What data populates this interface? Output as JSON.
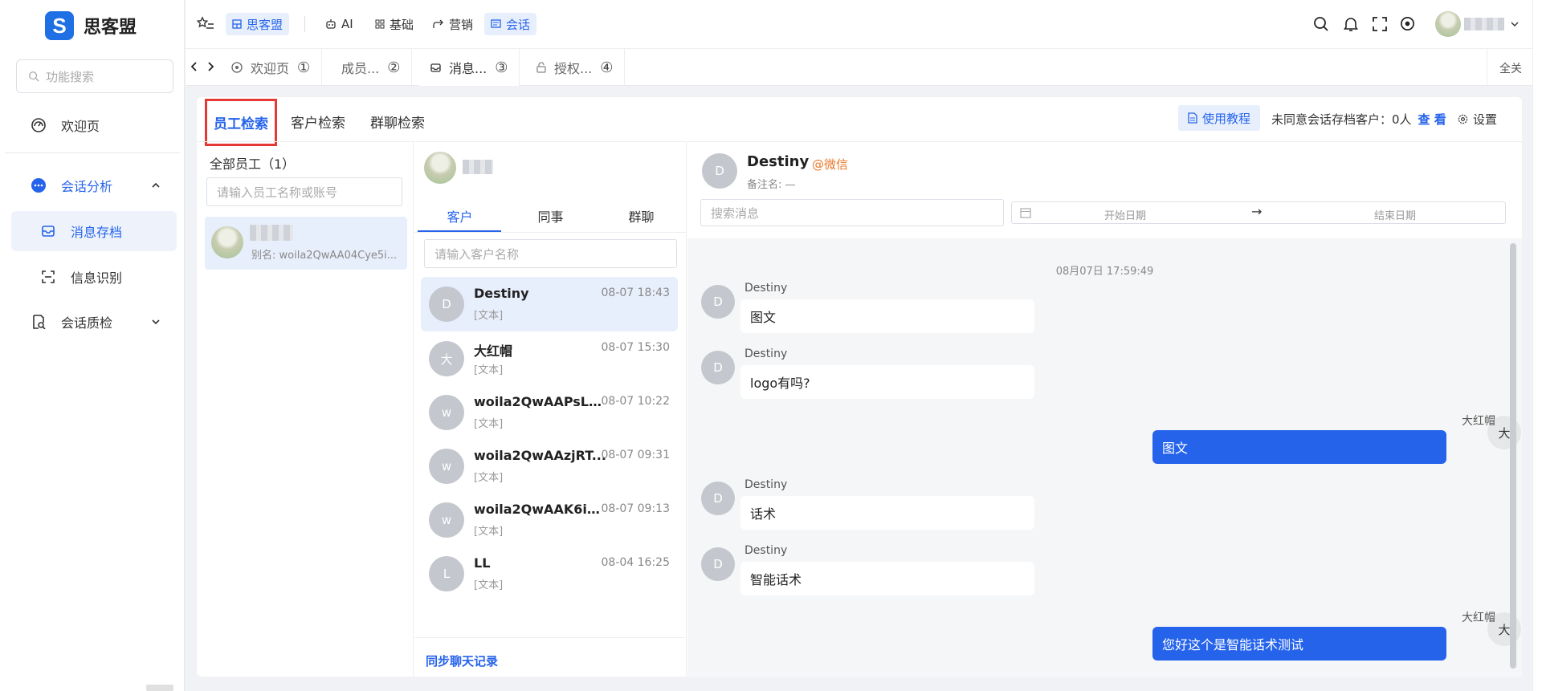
{
  "app": {
    "name": "思客盟",
    "logo_letter": "S",
    "brand_color": "#1f6fe5"
  },
  "sidebar": {
    "search_placeholder": "功能搜索",
    "items": [
      {
        "label": "欢迎页",
        "icon": "dashboard-icon"
      },
      {
        "label": "会话分析",
        "icon": "chat-bubble-icon",
        "expanded": true
      },
      {
        "label": "消息存档",
        "icon": "inbox-icon",
        "active": true
      },
      {
        "label": "信息识别",
        "icon": "scan-icon"
      },
      {
        "label": "会话质检",
        "icon": "inspect-icon",
        "expanded": false
      }
    ]
  },
  "topbar": {
    "menu": [
      {
        "label": "思客盟",
        "icon": "grid-icon",
        "active": true
      },
      {
        "label": "AI",
        "icon": "robot-icon"
      },
      {
        "label": "基础",
        "icon": "apps-icon"
      },
      {
        "label": "营销",
        "icon": "share-icon"
      },
      {
        "label": "会话",
        "icon": "message-icon",
        "active": true
      }
    ],
    "close_all": "全关"
  },
  "tabs": [
    {
      "label": "欢迎页",
      "num": "①",
      "icon": "dashboard-icon"
    },
    {
      "label": "成员...",
      "num": "②"
    },
    {
      "label": "消息...",
      "num": "③",
      "icon": "inbox-icon",
      "active": true
    },
    {
      "label": "授权...",
      "num": "④",
      "icon": "lock-icon"
    }
  ],
  "search_tabs": {
    "employee": "员工检索",
    "customer": "客户检索",
    "group": "群聊检索"
  },
  "toolbar": {
    "help": "使用教程",
    "consent_label": "未同意会话存档客户：0人",
    "view": "查 看",
    "settings": "设置"
  },
  "employees": {
    "header": "全部员工（1）",
    "search_placeholder": "请输入员工名称或账号",
    "list": [
      {
        "alias": "别名: woila2QwAA04Cye5i..."
      }
    ]
  },
  "contacts": {
    "tabs": [
      "客户",
      "同事",
      "群聊"
    ],
    "search_placeholder": "请输入客户名称",
    "list": [
      {
        "avatar": "D",
        "name": "Destiny",
        "time": "08-07 18:43",
        "preview": "[文本]"
      },
      {
        "avatar": "大",
        "name": "大红帽",
        "time": "08-07 15:30",
        "preview": "[文本]"
      },
      {
        "avatar": "w",
        "name": "woila2QwAAPsLA...",
        "time": "08-07 10:22",
        "preview": "[文本]"
      },
      {
        "avatar": "w",
        "name": "woila2QwAAzjRT...",
        "time": "08-07 09:31",
        "preview": "[文本]"
      },
      {
        "avatar": "w",
        "name": "woila2QwAAK6ia...",
        "time": "08-07 09:13",
        "preview": "[文本]"
      },
      {
        "avatar": "L",
        "name": "LL",
        "time": "08-04 16:25",
        "preview": "[文本]"
      }
    ],
    "sync": "同步聊天记录"
  },
  "chat": {
    "avatar": "D",
    "name": "Destiny",
    "source": "@微信",
    "remark": "备注名: —",
    "search_placeholder": "搜索消息",
    "start_date": "开始日期",
    "arrow": "→",
    "end_date": "结束日期",
    "time_divider": "08月07日 17:59:49",
    "messages": [
      {
        "side": "left",
        "avatar": "D",
        "sender": "Destiny",
        "text": "图文"
      },
      {
        "side": "left",
        "avatar": "D",
        "sender": "Destiny",
        "text": "logo有吗?"
      },
      {
        "side": "right",
        "avatar": "大",
        "sender": "大红帽",
        "text": "图文"
      },
      {
        "side": "left",
        "avatar": "D",
        "sender": "Destiny",
        "text": "话术"
      },
      {
        "side": "left",
        "avatar": "D",
        "sender": "Destiny",
        "text": "智能话术"
      },
      {
        "side": "right",
        "avatar": "大",
        "sender": "大红帽",
        "text": "您好这个是智能话术测试"
      }
    ]
  }
}
